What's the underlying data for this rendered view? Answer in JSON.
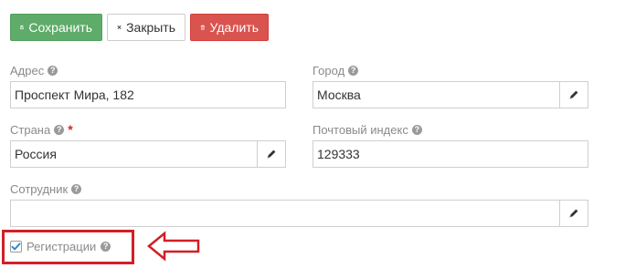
{
  "toolbar": {
    "save_label": "Сохранить",
    "close_label": "Закрыть",
    "delete_label": "Удалить"
  },
  "form": {
    "address": {
      "label": "Адрес",
      "value": "Проспект Мира, 182"
    },
    "city": {
      "label": "Город",
      "value": "Москва"
    },
    "country": {
      "label": "Страна",
      "required_mark": "*",
      "value": "Россия"
    },
    "postal_code": {
      "label": "Почтовый индекс",
      "value": "129333"
    },
    "employee": {
      "label": "Сотрудник",
      "value": ""
    },
    "registration": {
      "label": "Регистрации",
      "checked": true
    }
  },
  "icons": {
    "help": "?"
  },
  "colors": {
    "save": "#5fab69",
    "delete": "#d9534f",
    "highlight": "#d11f27",
    "checkmark": "#2a87c8"
  }
}
